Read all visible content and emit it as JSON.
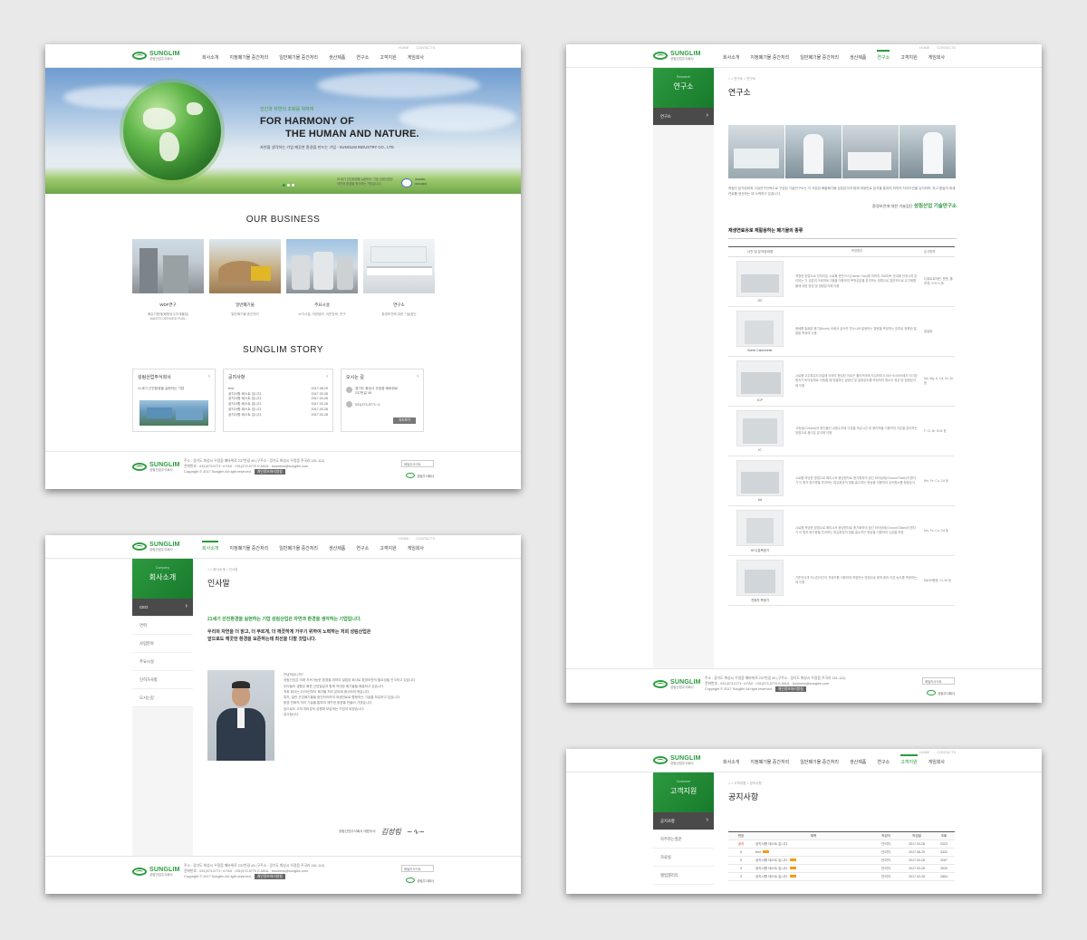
{
  "brand": {
    "name": "SUNGLIM",
    "sub": "성림산업주식회사"
  },
  "util": [
    "HOME",
    "CONTACTS"
  ],
  "nav": [
    "회사소개",
    "지정폐기물 중간처리",
    "일반폐기물 중간처리",
    "생산제품",
    "연구소",
    "고객지원",
    "게임회사"
  ],
  "home": {
    "hero": {
      "kor": "인간과 자연의 조화를 위하여",
      "en1": "FOR HARMONY OF",
      "en2": "THE HUMAN AND NATURE.",
      "sub": "자연을 생각하는 기업 깨끗한 환경을 만드는 기업 - SUNGLIM INDUSTRY CO., LTD",
      "cert1": "21세기 선진환경을 실현하는 기업 성림산업은",
      "cert2": "자연과 환경을 생각하는 기업입니다.",
      "cert_a": "ISO9001",
      "cert_b": "ISO14001"
    },
    "business_title": "OUR BUSINESS",
    "business": [
      {
        "name": "WDF연구",
        "desc1": "폐유기용제(폐합성수지계물질)",
        "desc2": "WASTE DERIVED FUEL"
      },
      {
        "name": "일반폐기물",
        "desc1": "일반폐기물 중간처리",
        "desc2": ""
      },
      {
        "name": "주요시설",
        "desc1": "소각시설, 저장탱크, 이운장비, 연구",
        "desc2": ""
      },
      {
        "name": "연구소",
        "desc1": "환경보전에 대한 기술집단",
        "desc2": ""
      }
    ],
    "story_title": "SUNGLIM STORY",
    "story": {
      "company": {
        "title": "성림산업주식회사",
        "desc": "21세기 선진환경을 실현하는 기업"
      },
      "notice": {
        "title": "공지사항",
        "items": [
          {
            "t": "test",
            "d": "2017.08.29"
          },
          {
            "t": "공지사항 테스트 입니다.",
            "d": "2017.03.28"
          },
          {
            "t": "공지사항 테스트 입니다.",
            "d": "2017.03.28"
          },
          {
            "t": "공지사항 테스트 입니다.",
            "d": "2017.03.28"
          },
          {
            "t": "공지사항 테스트 입니다.",
            "d": "2017.03.28"
          },
          {
            "t": "공지사항 테스트 입니다.",
            "d": "2017.03.28"
          }
        ]
      },
      "map": {
        "title": "오시는 길",
        "addr1": "경기도 화성시 우정읍 매바위로",
        "addr2": "237번길 45",
        "tel": "031)373-5771~4",
        "btn": "지도보기"
      }
    }
  },
  "footer": {
    "line1": "주소 : 경기도 화성시 우정읍 매바위로 237번길 45 (구주소 : 경기도 화성시 우정읍 주곡리 161-112)",
    "line2": "전화번호 : 031)373-5771~4 FAX : 031)373-5770 E-MAIL : business@sunglim.com",
    "line3": "Copyright © 2017 Sunglim All right reserved.",
    "badge": "개인정보처리방침",
    "select": "패밀리사이트",
    "corp": "성림주식회사"
  },
  "about": {
    "lnb_en": "Company",
    "lnb_title": "회사소개",
    "lnb": [
      "CEO",
      "연혁",
      "사업분야",
      "주요시설",
      "인허가사항",
      "오시는길"
    ],
    "crumb": "⌂ > 회사소개 > 인사말",
    "title": "인사말",
    "lead": "21세기 선진환경을 실현하는 기업 성림산업은 자연과 환경을 생각하는 기업입니다.",
    "lead2a": "우리의 자연을 더 맑고, 더 푸르게, 더 깨끗하게 가꾸기 위하여 노력하는 저희 성림산업은",
    "lead2b": "앞으로도 깨끗한 환경을 보존하는데 최선을 다할 것입니다.",
    "body": [
      "안녕하십니까?",
      "성림산업은 미래 지속가능한 환경을 위하여 설립된 회사로 환경보전의 필요성을 인식하고 있습니다.",
      "우리들의 생활은 빠른 산업발달과 함께 막대한 폐기물을 배출하고 있습니다.",
      "저희 회사는 1978년부터 폐기물 처리 분야에 종사하여 왔습니다.",
      "특히, 일반 산업폐기물을 중간처리하여 재생연료로 활용하는 기술을 보유하고 있습니다.",
      "환경 친화적 처리 기술을 통하여 깨끗한 환경을 만들어 가겠습니다.",
      "앞으로도 고객 여러분의 성원에 보답하는 기업이 되겠습니다.",
      "감사합니다."
    ],
    "sign_label": "성림산업주식회사 대표이사",
    "sign": "김성림"
  },
  "lab": {
    "lnb_en": "Research",
    "lnb_title": "연구소",
    "lnb": [
      "연구소"
    ],
    "crumb": "⌂ > 연구소 > 연구소",
    "title": "연구소",
    "desc": "최첨단 분석장비와 고급연구인력으로 구성된 기술연구소는 각 사업장 배출폐기물 성분분석과 함께 재생연료 분석을 통하여 최적의 처리조건을 유지하며, 최고 품질의 재생연료를 생산하는 데 노력하고 있습니다.",
    "link_label": "환경보전에 대한 기술집단",
    "link": "성림산업 기술연구소",
    "sub_title": "재생연료유로 재활용하는 폐기물의 종류",
    "head": [
      "사진 및 분석장비명",
      "측정원리",
      "분석항목"
    ],
    "rows": [
      {
        "name": "GC",
        "desc": "적정한 방법으로 전처리된 시료를 운반가스(Carrier Gas)에 의하여 크로마토 관내에 전개시켜 분리되는 각 성분의 크로마토그램을 이용하여 목적성분을 분석하는 방법으로 일반적으로 유기화합물에 대한 정성 및 정량분석에 이용.",
        "items": "디클로로메탄, 벤젠, 톨루엔, VOC's 등"
      },
      {
        "name": "Bomb Calorimeter",
        "desc": "봄베를 밀폐된 용기(Bomb) 속에서 급속히 연소시켜 발생하는 열량을 측정하는 장치로 정확한 발열량 측정에 사용.",
        "items": "발열량"
      },
      {
        "name": "ICP",
        "desc": "시료를 고주파유도코일에 의하여 형성된 아르곤 플라즈마에 도입하여 6,000~8,000K에서 여기된 원자가 바닥상태로 이동할 때 방출하는 발광선 및 발광강도를 측정하여 원소의 정성 및 정량분석에 이용.",
        "items": "Na, Mg, K, Ca, Ni, Zn 등"
      },
      {
        "name": "IC",
        "desc": "고정상(Column)의 충진물인 교환수지에 이온을 보유시킨 후 용리액을 이용하여 이온을 분리하는 방법으로 음이온 분석에 이용.",
        "items": "F, Cl, Br, SO4 등"
      },
      {
        "name": "AA",
        "desc": "시료를 적당한 방법으로 해리시켜 중성원자로 증기화하여 생긴 바닥상태(Ground State)의 원자가 이 원자 증기층을 투과하는 특유파장의 빛을 흡수하는 현상을 이용하여 금속원소를 정량분석.",
        "items": "Mn, Fe, Cu, Cd 등"
      },
      {
        "name": "KF수분측정기",
        "desc": "시료를 적당한 방법으로 해리시켜 중성원자로 증기화하여 생긴 바닥상태(Ground State)의 원자가 이 원자 증기층을 투과하는 특유파장의 빛을 흡수하는 현상을 이용하여 수분을 측정.",
        "items": "Mn, Fe, Cu, Cd 등"
      },
      {
        "name": "전위차 측정기",
        "desc": "기준전극과 지시전극간의 전위차를 이용하여 적정하는 방법으로 용액 중의 이온 농도를 측정하는데 이용.",
        "items": "NaOH함량, Cl, Br 등"
      }
    ]
  },
  "support": {
    "lnb_en": "Customer",
    "lnb_title": "고객지원",
    "lnb": [
      "공지사항",
      "자주하는질문",
      "자료실",
      "앨범갤러리"
    ],
    "crumb": "⌂ > 고객지원 > 공지사항",
    "title": "공지사항",
    "head": [
      "번호",
      "제목",
      "작성자",
      "작성일",
      "조회"
    ],
    "rows": [
      {
        "no": "공지",
        "t": "공지사항 테스트 입니다.",
        "w": "관리자",
        "d": "2017.03.28",
        "v": "2023"
      },
      {
        "no": "6",
        "t": "test",
        "w": "관리자",
        "d": "2017.08.29",
        "v": "3332"
      },
      {
        "no": "5",
        "t": "공지사항 테스트 입니다.",
        "w": "관리자",
        "d": "2017.03.28",
        "v": "3257"
      },
      {
        "no": "4",
        "t": "공지사항 테스트 입니다.",
        "w": "관리자",
        "d": "2017.03.28",
        "v": "3025"
      },
      {
        "no": "3",
        "t": "공지사항 테스트 입니다.",
        "w": "관리자",
        "d": "2017.03.28",
        "v": "2854"
      }
    ]
  }
}
